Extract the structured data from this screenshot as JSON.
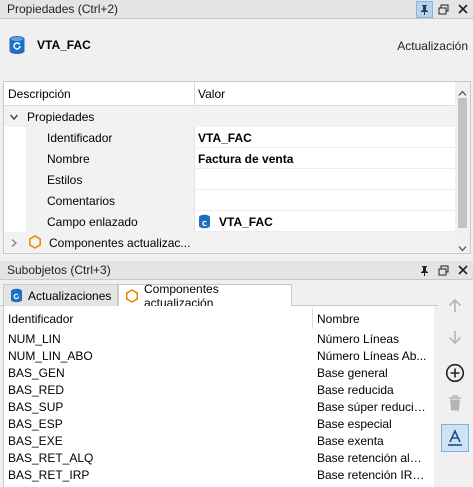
{
  "properties_panel": {
    "title": "Propiedades (Ctrl+2)",
    "object_name": "VTA_FAC",
    "object_type": "Actualización",
    "grid": {
      "col_description": "Descripción",
      "col_value": "Valor",
      "section_label": "Propiedades",
      "rows": [
        {
          "label": "Identificador",
          "value": "VTA_FAC"
        },
        {
          "label": "Nombre",
          "value": "Factura de venta"
        },
        {
          "label": "Estilos",
          "value": ""
        },
        {
          "label": "Comentarios",
          "value": ""
        },
        {
          "label": "Campo enlazado",
          "value": "VTA_FAC"
        }
      ],
      "collapsed_section_label": "Componentes actualizac..."
    }
  },
  "subobjects_panel": {
    "title": "Subobjetos (Ctrl+3)",
    "tabs": [
      {
        "label": "Actualizaciones"
      },
      {
        "label": "Componentes actualización"
      }
    ],
    "list": {
      "col_identifier": "Identificador",
      "col_name": "Nombre",
      "rows": [
        {
          "id": "NUM_LIN",
          "name": "Número Líneas"
        },
        {
          "id": "NUM_LIN_ABO",
          "name": "Número Líneas Ab..."
        },
        {
          "id": "BAS_GEN",
          "name": "Base general"
        },
        {
          "id": "BAS_RED",
          "name": "Base reducida"
        },
        {
          "id": "BAS_SUP",
          "name": "Base súper reducida"
        },
        {
          "id": "BAS_ESP",
          "name": "Base especial"
        },
        {
          "id": "BAS_EXE",
          "name": "Base exenta"
        },
        {
          "id": "BAS_RET_ALQ",
          "name": "Base retención alqu..."
        },
        {
          "id": "BAS_RET_IRP",
          "name": "Base retención IRPF"
        }
      ]
    }
  },
  "icons": {
    "pin": "pin-icon",
    "restore": "restore-window-icon",
    "close": "close-icon",
    "update_object": "database-refresh-icon",
    "component": "hexagon-icon",
    "move_up": "arrow-up-icon",
    "move_down": "arrow-down-icon",
    "add": "add-circle-icon",
    "delete": "trash-icon",
    "font": "font-underline-icon"
  },
  "colors": {
    "accent": "#1e6fc0",
    "component_orange": "#e8900c"
  }
}
